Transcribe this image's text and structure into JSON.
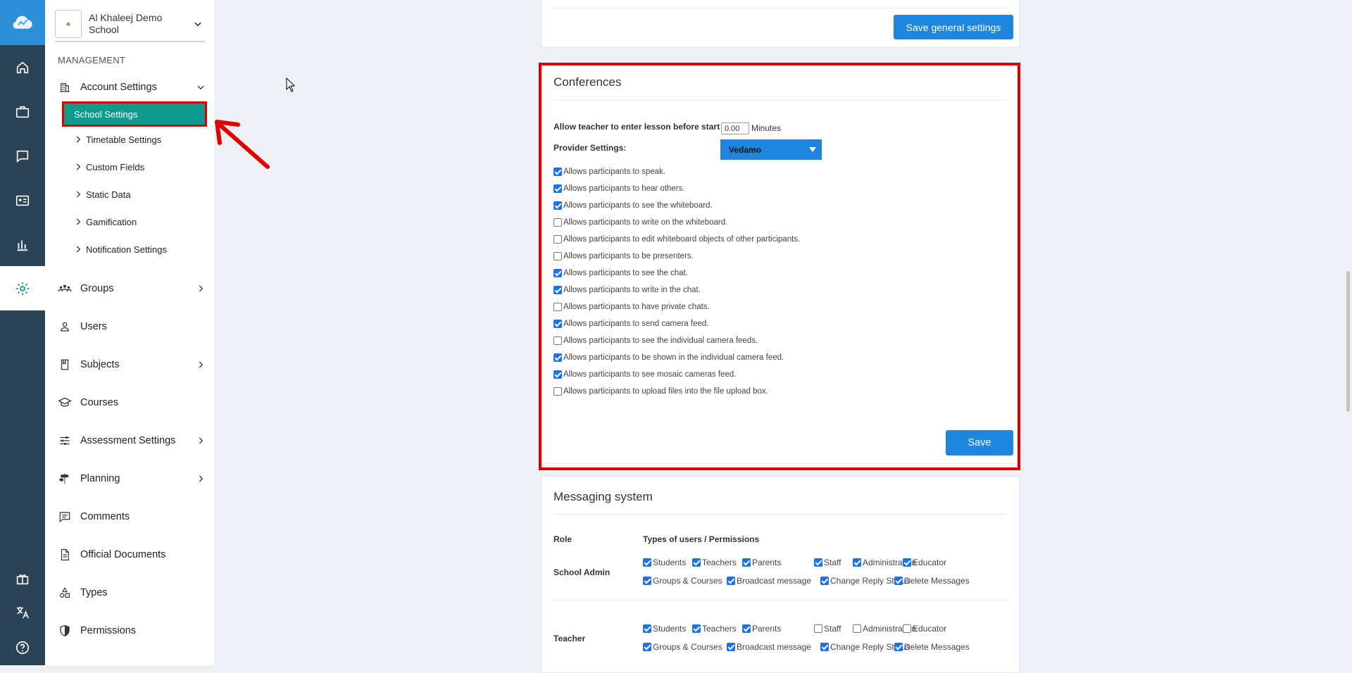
{
  "school": {
    "name": "Al Khaleej Demo School",
    "logo_text": "♣"
  },
  "sidebar": {
    "section_label": "MANAGEMENT",
    "account_settings": "Account Settings",
    "school_settings": "School Settings",
    "sub_items": [
      "Timetable Settings",
      "Custom Fields",
      "Static Data",
      "Gamification",
      "Notification Settings"
    ],
    "items": [
      "Groups",
      "Users",
      "Subjects",
      "Courses",
      "Assessment Settings",
      "Planning",
      "Comments",
      "Official Documents",
      "Types",
      "Permissions"
    ]
  },
  "general": {
    "save_button": "Save general settings"
  },
  "conferences": {
    "title": "Conferences",
    "allow_enter_label": "Allow teacher to enter lesson before start",
    "allow_enter_value": "0.00",
    "minutes_label": "Minutes",
    "provider_label": "Provider Settings:",
    "provider_value": "Vedamo",
    "permissions": [
      {
        "label": "Allows participants to speak.",
        "checked": true
      },
      {
        "label": "Allows participants to hear others.",
        "checked": true
      },
      {
        "label": "Allows participants to see the whiteboard.",
        "checked": true
      },
      {
        "label": "Allows participants to write on the whiteboard.",
        "checked": false
      },
      {
        "label": "Allows participants to edit whiteboard objects of other participants.",
        "checked": false
      },
      {
        "label": "Allows participants to be presenters.",
        "checked": false
      },
      {
        "label": "Allows participants to see the chat.",
        "checked": true
      },
      {
        "label": "Allows participants to write in the chat.",
        "checked": true
      },
      {
        "label": "Allows participants to have private chats.",
        "checked": false
      },
      {
        "label": "Allows participants to send camera feed.",
        "checked": true
      },
      {
        "label": "Allows participants to see the individual camera feeds.",
        "checked": false
      },
      {
        "label": "Allows participants to be shown in the individual camera feed.",
        "checked": true
      },
      {
        "label": "Allows participants to see mosaic cameras feed.",
        "checked": true
      },
      {
        "label": "Allows participants to upload files into the file upload box.",
        "checked": false
      }
    ],
    "save_button": "Save"
  },
  "messaging": {
    "title": "Messaging system",
    "role_header": "Role",
    "types_header": "Types of users / Permissions",
    "roles": [
      {
        "name": "School Admin",
        "row1": [
          {
            "label": "Students",
            "checked": true
          },
          {
            "label": "Teachers",
            "checked": true
          },
          {
            "label": "Parents",
            "checked": true
          },
          {
            "label": "Staff",
            "checked": true
          },
          {
            "label": "Administration",
            "checked": true
          },
          {
            "label": "Educator",
            "checked": true
          }
        ],
        "row2": [
          {
            "label": "Groups & Courses",
            "checked": true
          },
          {
            "label": "Broadcast message",
            "checked": true
          },
          {
            "label": "Change Reply Status",
            "checked": true
          },
          {
            "label": "Delete Messages",
            "checked": true
          }
        ]
      },
      {
        "name": "Teacher",
        "row1": [
          {
            "label": "Students",
            "checked": true
          },
          {
            "label": "Teachers",
            "checked": true
          },
          {
            "label": "Parents",
            "checked": true
          },
          {
            "label": "Staff",
            "checked": false
          },
          {
            "label": "Administration",
            "checked": false
          },
          {
            "label": "Educator",
            "checked": false
          }
        ],
        "row2": [
          {
            "label": "Groups & Courses",
            "checked": true
          },
          {
            "label": "Broadcast message",
            "checked": true
          },
          {
            "label": "Change Reply Status",
            "checked": true
          },
          {
            "label": "Delete Messages",
            "checked": true
          }
        ]
      }
    ]
  },
  "colors": {
    "rail": "#2b4356",
    "accent": "#1f86e0",
    "active": "#0f9a8e",
    "highlight": "#e00000"
  }
}
